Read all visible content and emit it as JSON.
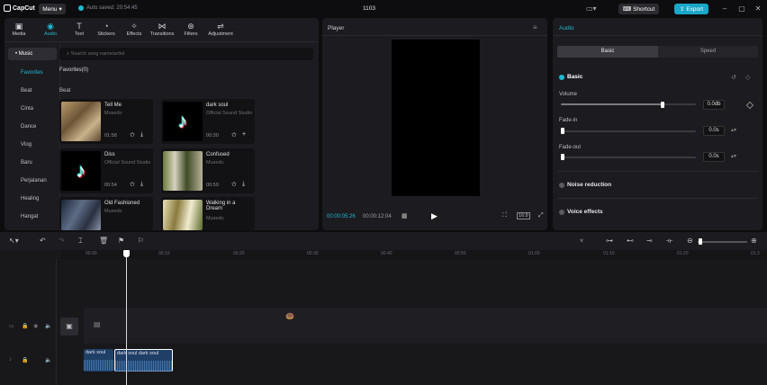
{
  "titlebar": {
    "logo": "CapCut",
    "menu": "Menu",
    "autosave": "Auto saved: 20:54:45",
    "project_title": "1103",
    "shortcut": "Shortcut",
    "export": "Export"
  },
  "toolbar": [
    {
      "label": "Media",
      "icon": "media-icon"
    },
    {
      "label": "Audio",
      "icon": "audio-icon"
    },
    {
      "label": "Text",
      "icon": "text-icon"
    },
    {
      "label": "Stickers",
      "icon": "stickers-icon"
    },
    {
      "label": "Effects",
      "icon": "effects-icon"
    },
    {
      "label": "Transitions",
      "icon": "transitions-icon"
    },
    {
      "label": "Filters",
      "icon": "filters-icon"
    },
    {
      "label": "Adjustment",
      "icon": "adjustment-icon"
    }
  ],
  "sidebar": [
    "• Music",
    "Favorites",
    "Beat",
    "Cinta",
    "Dance",
    "Vlog",
    "Baru",
    "Perjalanan",
    "Healing",
    "Hangat"
  ],
  "search_placeholder": "Search song name/artist",
  "favorites_label": "Favorites(0)",
  "beat_label": "Beat",
  "tracks": [
    {
      "title": "Tell Me",
      "artist": "Musedo",
      "duration": "01:58"
    },
    {
      "title": "dark soul",
      "artist": "Official Sound Studio",
      "duration": "00:30"
    },
    {
      "title": "Diss",
      "artist": "Official Sound Studio",
      "duration": "00:54"
    },
    {
      "title": "Confused",
      "artist": "Musedo",
      "duration": "00:59"
    },
    {
      "title": "Old Fashioned",
      "artist": "Musedo",
      "duration": ""
    },
    {
      "title": "Walking in a Dream",
      "artist": "Musedo",
      "duration": ""
    }
  ],
  "player": {
    "title": "Player",
    "current_time": "00:00:05:26",
    "total_time": "00:00:12:04"
  },
  "audio_panel": {
    "title": "Audio",
    "tab_basic": "Basic",
    "tab_speed": "Speed",
    "basic_section": "Basic",
    "volume_label": "Volume",
    "volume_value": "0.0db",
    "volume_level": 0.75,
    "fadein_label": "Fade-in",
    "fadein_value": "0.0s",
    "fadeout_label": "Fade-out",
    "fadeout_value": "0.0s",
    "noise_reduction": "Noise reduction",
    "voice_effects": "Voice effects"
  },
  "ruler": [
    "00:00",
    "00:10",
    "00:20",
    "00:30",
    "00:40",
    "00:50",
    "01:00",
    "01:10",
    "01:20",
    "01:3"
  ],
  "audio_clips": [
    {
      "label": "dark soul"
    },
    {
      "label": "dark soul dark soul"
    }
  ],
  "colors": {
    "accent": "#22b8cf",
    "panel": "#1c1c20",
    "clip": "#1f3f66"
  }
}
